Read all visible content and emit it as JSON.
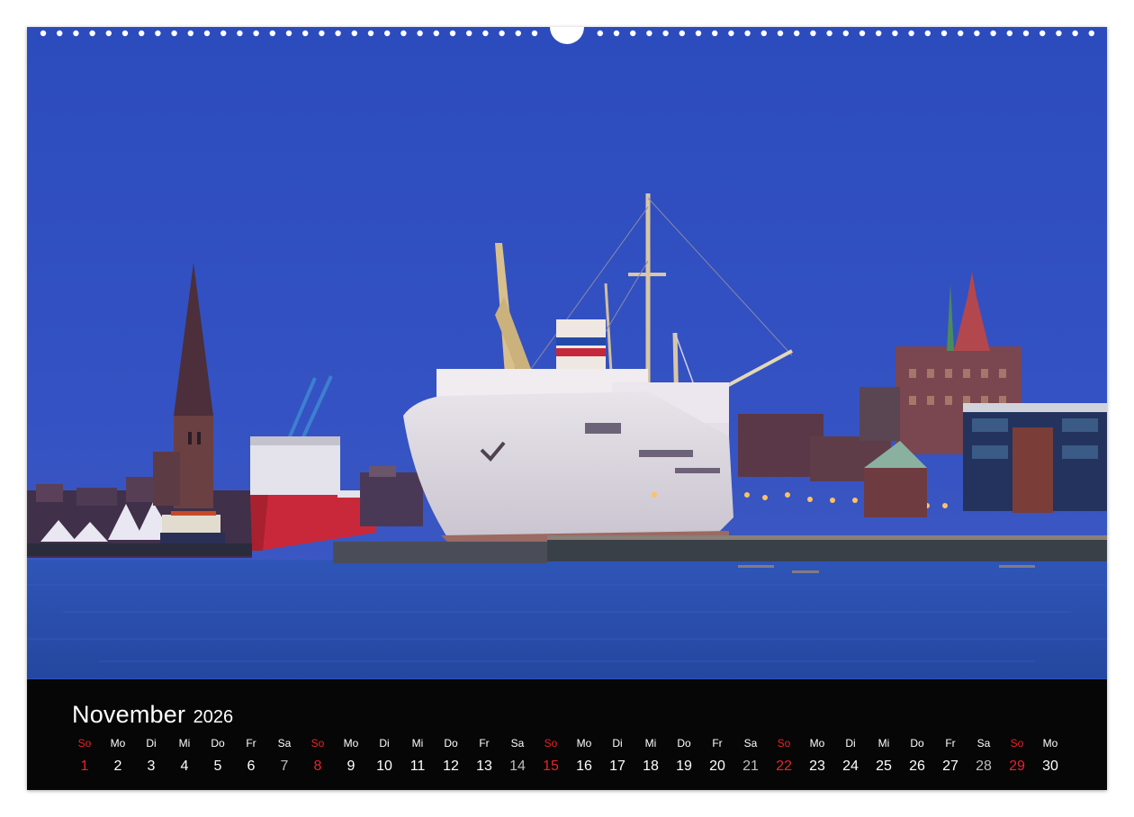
{
  "calendar": {
    "month": "November",
    "year": "2026",
    "days": [
      {
        "wd": "So",
        "day": "1",
        "sunday": true
      },
      {
        "wd": "Mo",
        "day": "2"
      },
      {
        "wd": "Di",
        "day": "3"
      },
      {
        "wd": "Mi",
        "day": "4"
      },
      {
        "wd": "Do",
        "day": "5"
      },
      {
        "wd": "Fr",
        "day": "6"
      },
      {
        "wd": "Sa",
        "day": "7",
        "saturday": true
      },
      {
        "wd": "So",
        "day": "8",
        "sunday": true
      },
      {
        "wd": "Mo",
        "day": "9"
      },
      {
        "wd": "Di",
        "day": "10"
      },
      {
        "wd": "Mi",
        "day": "11"
      },
      {
        "wd": "Do",
        "day": "12"
      },
      {
        "wd": "Fr",
        "day": "13"
      },
      {
        "wd": "Sa",
        "day": "14",
        "saturday": true
      },
      {
        "wd": "So",
        "day": "15",
        "sunday": true
      },
      {
        "wd": "Mo",
        "day": "16"
      },
      {
        "wd": "Di",
        "day": "17"
      },
      {
        "wd": "Mi",
        "day": "18"
      },
      {
        "wd": "Do",
        "day": "19"
      },
      {
        "wd": "Fr",
        "day": "20"
      },
      {
        "wd": "Sa",
        "day": "21",
        "saturday": true
      },
      {
        "wd": "So",
        "day": "22",
        "sunday": true
      },
      {
        "wd": "Mo",
        "day": "23"
      },
      {
        "wd": "Di",
        "day": "24"
      },
      {
        "wd": "Mi",
        "day": "25"
      },
      {
        "wd": "Do",
        "day": "26"
      },
      {
        "wd": "Fr",
        "day": "27"
      },
      {
        "wd": "Sa",
        "day": "28",
        "saturday": true
      },
      {
        "wd": "So",
        "day": "29",
        "sunday": true
      },
      {
        "wd": "Mo",
        "day": "30"
      }
    ]
  },
  "colors": {
    "sky": "#2f4ec0",
    "water": "#284aa8",
    "calendar_bar": "#060606",
    "sunday": "#e8222a",
    "saturday": "#bdbdbd",
    "weekday": "#ffffff"
  },
  "photo": {
    "subject": "harbor-at-blue-hour-with-museum-ship"
  }
}
